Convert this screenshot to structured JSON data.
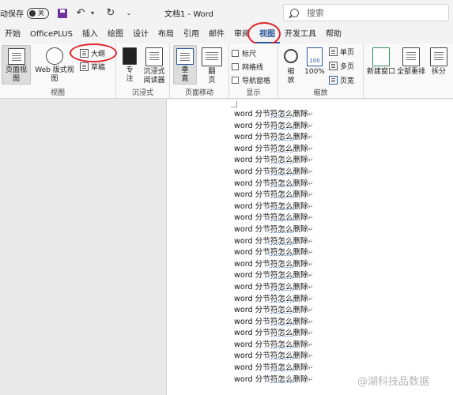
{
  "titlebar": {
    "autosave_label": "动保存",
    "toggle_state": "关",
    "doc_title": "文档1 - Word"
  },
  "search": {
    "placeholder": "搜索"
  },
  "tabs": [
    {
      "label": "开始"
    },
    {
      "label": "OfficePLUS"
    },
    {
      "label": "插入"
    },
    {
      "label": "绘图"
    },
    {
      "label": "设计"
    },
    {
      "label": "布局"
    },
    {
      "label": "引用"
    },
    {
      "label": "邮件"
    },
    {
      "label": "审阅"
    },
    {
      "label": "视图",
      "active": true
    },
    {
      "label": "开发工具"
    },
    {
      "label": "帮助"
    }
  ],
  "ribbon": {
    "views": {
      "print_layout": "页面视图",
      "web_layout": "Web 版式视图",
      "outline": "大纲",
      "draft": "草稿",
      "group_label": "视图"
    },
    "immersive": {
      "focus_line1": "专",
      "focus_line2": "注",
      "reader_line1": "沉浸式",
      "reader_line2": "阅读器",
      "group_label": "沉浸式"
    },
    "page_movement": {
      "vertical_line1": "垂",
      "vertical_line2": "直",
      "side_line1": "翻",
      "side_line2": "页",
      "group_label": "页面移动"
    },
    "show": {
      "ruler": "标尺",
      "gridlines": "网格线",
      "nav_pane": "导航窗格",
      "group_label": "显示"
    },
    "zoom": {
      "zoom_line1": "缩",
      "zoom_line2": "放",
      "percent": "100%",
      "one_page": "单页",
      "multi_page": "多页",
      "page_width": "页宽",
      "group_label": "缩放"
    },
    "window": {
      "new_window": "新建窗口",
      "arrange_all": "全部重排",
      "split": "拆分"
    }
  },
  "document": {
    "line_prefix": "word ",
    "line_a": "分节",
    "line_u": "符怎么",
    "line_b": "删除",
    "paragraph_mark": "↵",
    "line_count": 24
  },
  "watermark": "@湖科技品数据",
  "colors": {
    "accent": "#2b579a",
    "annotation_ring": "#e0242a",
    "save_icon": "#7030a0"
  }
}
